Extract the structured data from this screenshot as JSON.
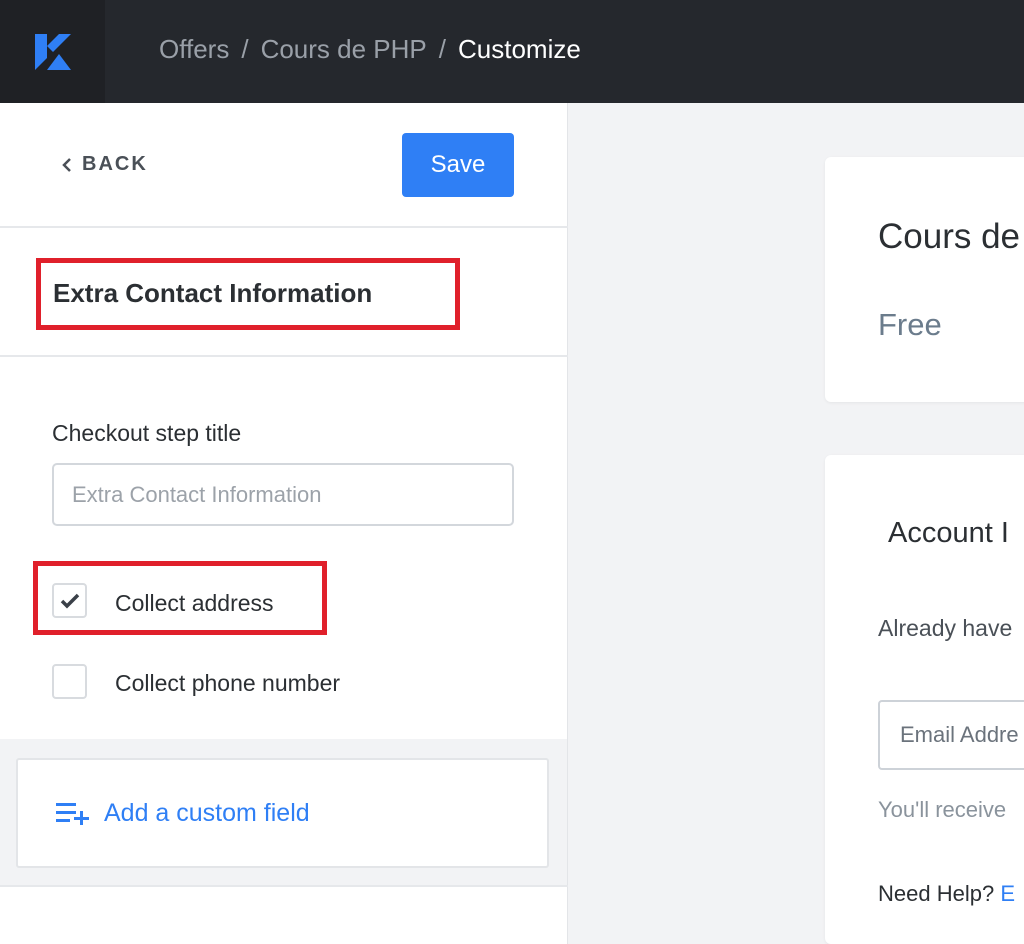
{
  "brand": {
    "logo_icon": "kajabi-logo-icon",
    "accent": "#2f7ff5",
    "highlight": "#e0202b"
  },
  "breadcrumb": {
    "items": [
      "Offers",
      "Cours de PHP"
    ],
    "separator": "/",
    "current": "Customize"
  },
  "sidebar": {
    "back_label": "BACK",
    "save_label": "Save",
    "section_title": "Extra Contact Information",
    "step_title_label": "Checkout step title",
    "step_title_placeholder": "Extra Contact Information",
    "options": [
      {
        "label": "Collect address",
        "checked": true
      },
      {
        "label": "Collect phone number",
        "checked": false
      }
    ],
    "add_custom_field_label": "Add a custom field"
  },
  "preview": {
    "product_title": "Cours de",
    "price": "Free",
    "account_title": "Account I",
    "account_text": "Already have",
    "email_placeholder": "Email Addre",
    "email_note": "You'll receive",
    "help_text": "Need Help?",
    "help_link": "E"
  }
}
